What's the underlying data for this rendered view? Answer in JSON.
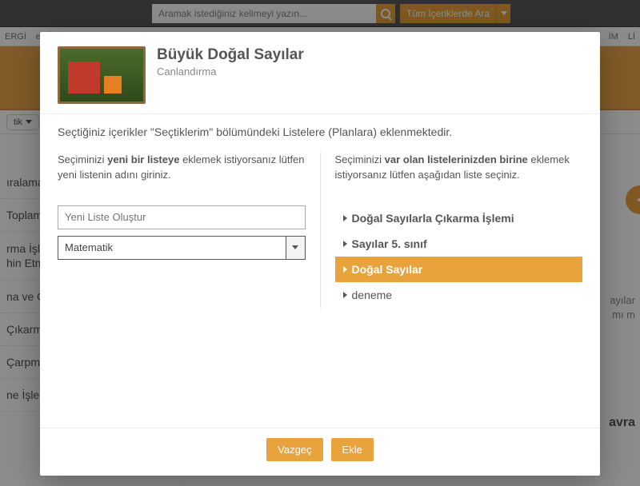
{
  "topbar": {
    "search_placeholder": "Aramak istediğiniz kelimeyi yazın...",
    "filter_label": "Tüm İçeriklerde Ara"
  },
  "nav": {
    "left1": "ERGİ",
    "left2": "e-KİTA",
    "right1": "İM",
    "right2": "Lİ"
  },
  "crumb": "tik",
  "sidebar": {
    "items": [
      "ıralama",
      "Toplama İş",
      "rma İşlem\nhin Etme",
      "na ve Çıka",
      "Çıkarma İş",
      "Çarpma İşl",
      "ne İşlemin"
    ]
  },
  "content": {
    "rt1": "ayılar",
    "rt2": "mı m",
    "rt3": "avra"
  },
  "modal": {
    "title": "Büyük Doğal Sayılar",
    "subtitle": "Canlandırma",
    "intro": "Seçtiğiniz içerikler \"Seçtiklerim\" bölümündeki Listelere (Planlara) eklenmektedir.",
    "left": {
      "msg_pre": "Seçiminizi ",
      "msg_bold": "yeni bir listeye",
      "msg_post": " eklemek istiyorsanız lütfen yeni listenin adını giriniz.",
      "new_list_placeholder": "Yeni Liste Oluştur",
      "select_value": "Matematik"
    },
    "right": {
      "msg_pre": "Seçiminizi ",
      "msg_bold": "var olan listelerinizden birine",
      "msg_post": " eklemek istiyorsanız lütfen aşağıdan liste seçiniz.",
      "items": [
        {
          "label": "Doğal Sayılarla Çıkarma İşlemi",
          "selected": false
        },
        {
          "label": "Sayılar 5. sınıf",
          "selected": false
        },
        {
          "label": "Doğal Sayılar",
          "selected": true
        },
        {
          "label": "deneme",
          "selected": false
        }
      ]
    },
    "footer": {
      "cancel": "Vazgeç",
      "add": "Ekle"
    }
  }
}
